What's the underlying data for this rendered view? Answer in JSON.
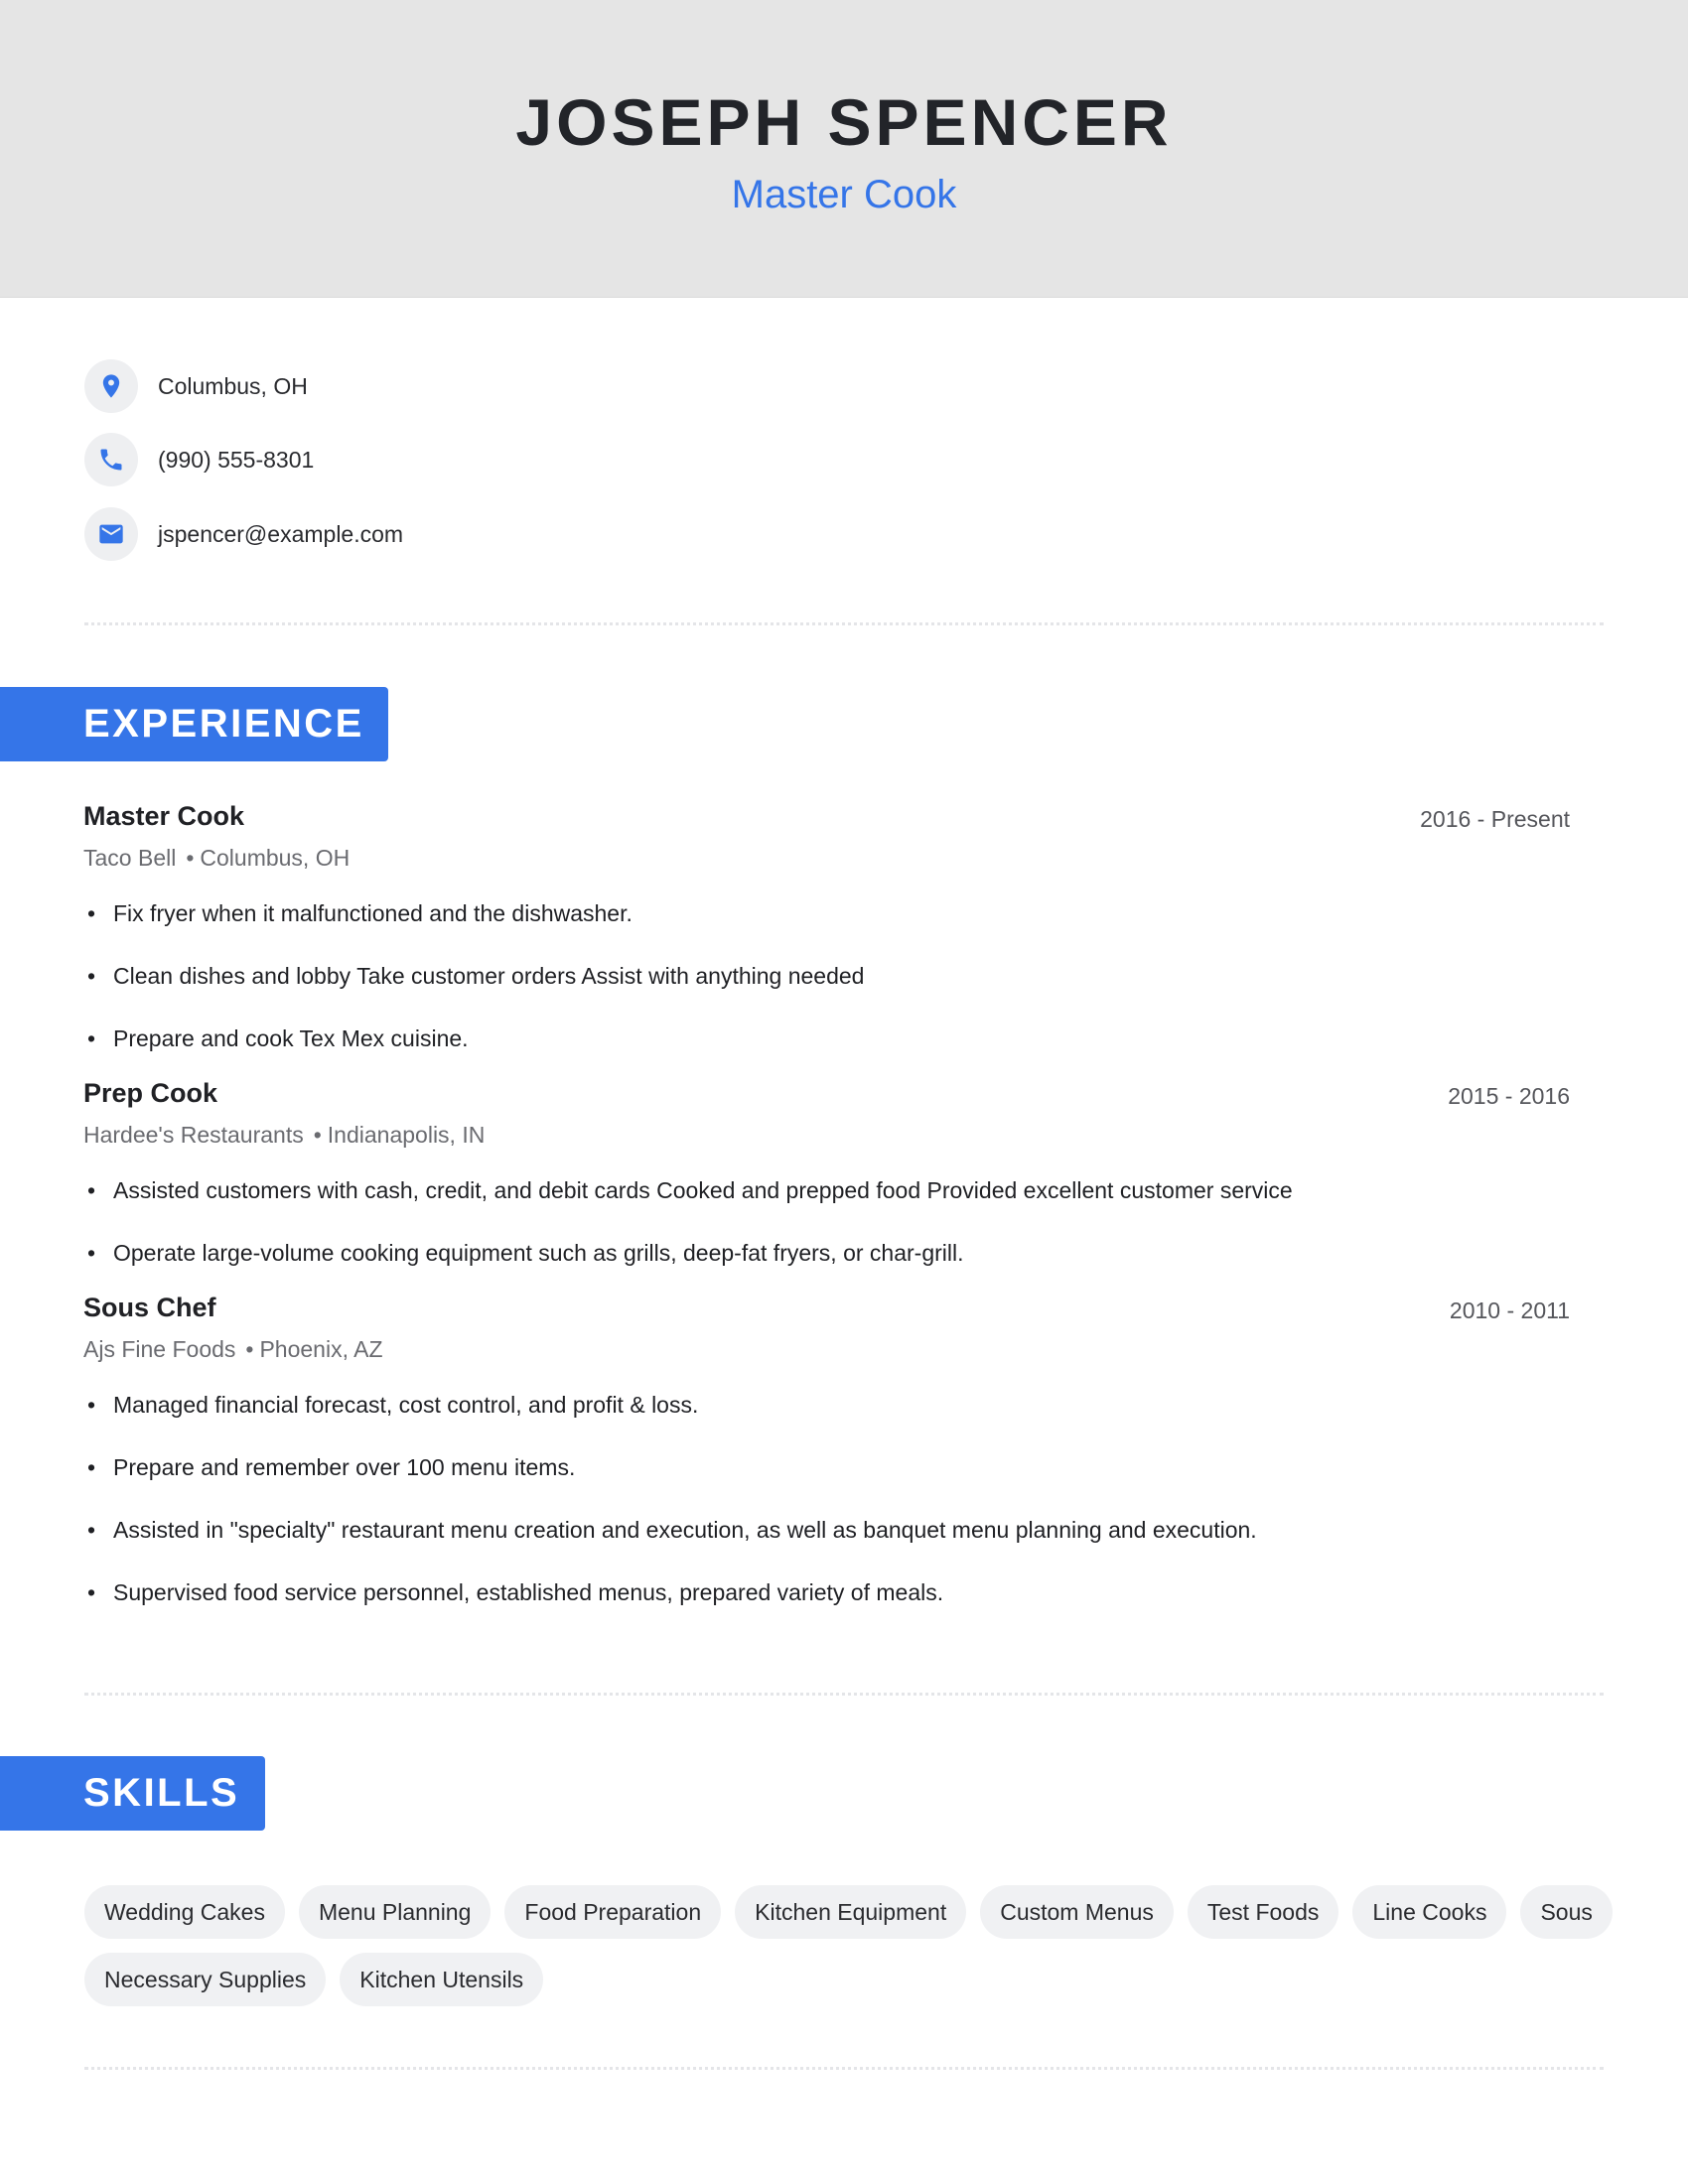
{
  "header": {
    "name": "JOSEPH SPENCER",
    "title": "Master Cook"
  },
  "contact": [
    {
      "icon": "location-pin-icon",
      "text": "Columbus, OH"
    },
    {
      "icon": "phone-icon",
      "text": "(990) 555-8301"
    },
    {
      "icon": "email-icon",
      "text": "jspencer@example.com"
    }
  ],
  "experience": {
    "heading": "EXPERIENCE",
    "jobs": [
      {
        "title": "Master Cook",
        "company": "Taco Bell",
        "location": "Columbus, OH",
        "dates": "2016 - Present",
        "bullets": [
          "Fix fryer when it malfunctioned and the dishwasher.",
          "Clean dishes and lobby Take customer orders Assist with anything needed",
          "Prepare and cook Tex Mex cuisine."
        ]
      },
      {
        "title": "Prep Cook",
        "company": "Hardee's Restaurants",
        "location": "Indianapolis, IN",
        "dates": "2015 - 2016",
        "bullets": [
          "Assisted customers with cash, credit, and debit cards Cooked and prepped food Provided excellent customer service",
          "Operate large-volume cooking equipment such as grills, deep-fat fryers, or char-grill."
        ]
      },
      {
        "title": "Sous Chef",
        "company": "Ajs Fine Foods",
        "location": "Phoenix, AZ",
        "dates": "2010 - 2011",
        "bullets": [
          "Managed financial forecast, cost control, and profit & loss.",
          "Prepare and remember over 100 menu items.",
          "Assisted in \"specialty\" restaurant menu creation and execution, as well as banquet menu planning and execution.",
          "Supervised food service personnel, established menus, prepared variety of meals."
        ]
      }
    ]
  },
  "skills": {
    "heading": "SKILLS",
    "items": [
      "Wedding Cakes",
      "Menu Planning",
      "Food Preparation",
      "Kitchen Equipment",
      "Custom Menus",
      "Test Foods",
      "Line Cooks",
      "Sous",
      "Necessary Supplies",
      "Kitchen Utensils"
    ]
  },
  "separator": "•",
  "bullet_glyph": "•",
  "colors": {
    "accent": "#3575e8",
    "header_bg": "#e5e5e5",
    "chip_bg": "#f0f1f3"
  }
}
